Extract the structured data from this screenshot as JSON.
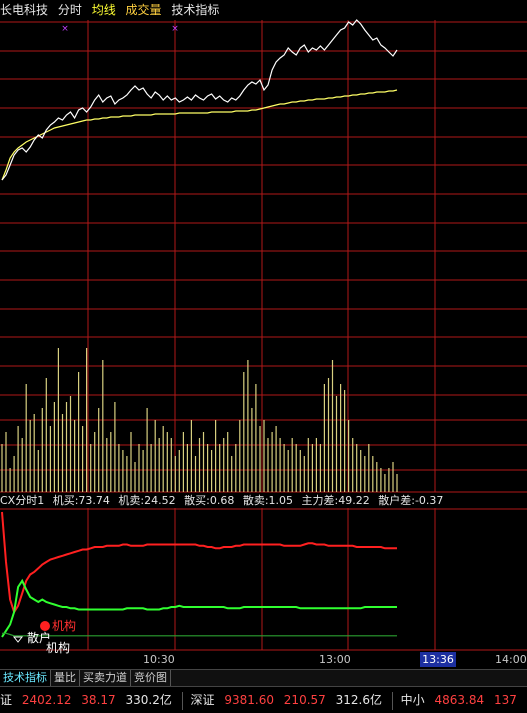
{
  "header": {
    "stock_name": "长电科技",
    "mode_label": "分时",
    "avg_label": "均线",
    "volume_label": "成交量",
    "indicator_label": "技术指标"
  },
  "colors": {
    "price": "#ffffff",
    "avg": "#ffff66",
    "volume": "#d8d080",
    "grid": "#b01818",
    "inst": "#ff2020",
    "retail": "#30ff30",
    "diff": "#2aa030"
  },
  "price_chart": {
    "price": [
      180,
      175,
      165,
      155,
      150,
      148,
      152,
      147,
      140,
      135,
      138,
      130,
      125,
      122,
      118,
      120,
      115,
      112,
      118,
      110,
      108,
      112,
      107,
      100,
      95,
      102,
      98,
      96,
      104,
      100,
      98,
      95,
      90,
      86,
      90,
      88,
      94,
      98,
      92,
      95,
      100,
      96,
      100,
      98,
      102,
      100,
      97,
      100,
      95,
      98,
      100,
      96,
      94,
      99,
      96,
      100,
      102,
      98,
      100,
      96,
      90,
      85,
      82,
      84,
      80,
      90,
      85,
      70,
      62,
      58,
      55,
      48,
      52,
      55,
      48,
      45,
      52,
      48,
      50,
      46,
      50,
      45,
      40,
      35,
      30,
      28,
      22,
      25,
      20,
      24,
      30,
      35,
      40,
      38,
      45,
      48,
      52,
      56,
      50
    ],
    "avg": [
      180,
      170,
      158,
      152,
      148,
      145,
      142,
      140,
      138,
      136,
      134,
      132,
      130,
      128,
      127,
      126,
      125,
      124,
      123,
      122,
      121,
      120,
      120,
      119,
      119,
      118,
      118,
      117,
      117,
      117,
      116,
      116,
      116,
      115,
      115,
      115,
      115,
      115,
      114,
      114,
      114,
      114,
      114,
      114,
      113,
      113,
      113,
      113,
      113,
      113,
      113,
      113,
      112,
      112,
      112,
      112,
      112,
      112,
      111,
      111,
      111,
      111,
      110,
      110,
      109,
      108,
      107,
      106,
      105,
      104,
      104,
      103,
      102,
      102,
      101,
      101,
      100,
      100,
      99,
      99,
      99,
      98,
      98,
      97,
      97,
      96,
      96,
      95,
      95,
      94,
      94,
      93,
      93,
      92,
      92,
      92,
      91,
      91,
      90
    ],
    "volume": [
      40,
      50,
      20,
      30,
      55,
      45,
      90,
      60,
      65,
      35,
      70,
      95,
      55,
      75,
      120,
      65,
      75,
      80,
      60,
      100,
      55,
      120,
      40,
      50,
      70,
      110,
      45,
      50,
      75,
      40,
      35,
      30,
      50,
      25,
      40,
      35,
      70,
      40,
      60,
      45,
      55,
      50,
      45,
      30,
      35,
      50,
      40,
      60,
      30,
      45,
      50,
      40,
      35,
      60,
      40,
      45,
      50,
      30,
      40,
      60,
      100,
      110,
      70,
      90,
      55,
      60,
      45,
      50,
      55,
      45,
      40,
      35,
      45,
      40,
      35,
      30,
      45,
      40,
      45,
      40,
      90,
      95,
      110,
      80,
      90,
      85,
      60,
      45,
      40,
      35,
      30,
      40,
      30,
      25,
      20,
      15,
      20,
      25,
      15
    ]
  },
  "indicator": {
    "title": "CX分时1",
    "values": [
      {
        "label": "机买:73.74",
        "color": "#e6e6e6"
      },
      {
        "label": "机卖:24.52",
        "color": "#e6e6e6"
      },
      {
        "label": "散买:0.68",
        "color": "#e6e6e6"
      },
      {
        "label": "散卖:1.05",
        "color": "#e6e6e6"
      },
      {
        "label": "主力差:49.22",
        "color": "#e6e6e6"
      },
      {
        "label": "散户差:-0.37",
        "color": "#e6e6e6"
      }
    ],
    "inst_line": [
      100,
      60,
      30,
      20,
      25,
      35,
      45,
      50,
      52,
      55,
      58,
      60,
      62,
      63,
      64,
      65,
      66,
      67,
      68,
      69,
      70,
      70,
      71,
      72,
      72,
      72,
      73,
      73,
      73,
      73,
      74,
      74,
      73,
      73,
      73,
      73,
      74,
      74,
      74,
      74,
      74,
      74,
      74,
      74,
      74,
      74,
      74,
      74,
      74,
      73,
      73,
      72,
      72,
      71,
      71,
      72,
      72,
      72,
      73,
      73,
      74,
      74,
      74,
      74,
      74,
      74,
      74,
      74,
      74,
      74,
      73,
      73,
      73,
      73,
      73,
      74,
      75,
      75,
      74,
      74,
      74,
      73,
      73,
      73,
      73,
      73,
      73,
      73,
      72,
      72,
      72,
      72,
      72,
      72,
      72,
      71,
      71,
      71,
      71
    ],
    "retail_line": [
      0,
      5,
      10,
      20,
      40,
      45,
      38,
      32,
      30,
      28,
      30,
      28,
      27,
      26,
      25,
      24,
      24,
      23,
      23,
      22,
      22,
      22,
      22,
      22,
      22,
      22,
      22,
      22,
      22,
      22,
      22,
      23,
      23,
      23,
      23,
      23,
      22,
      22,
      22,
      22,
      23,
      23,
      24,
      24,
      25,
      24,
      24,
      24,
      24,
      24,
      24,
      24,
      24,
      24,
      24,
      24,
      23,
      23,
      23,
      23,
      24,
      24,
      24,
      24,
      24,
      24,
      24,
      24,
      24,
      24,
      24,
      24,
      24,
      24,
      23,
      23,
      23,
      23,
      23,
      23,
      23,
      23,
      23,
      23,
      23,
      23,
      23,
      23,
      23,
      23,
      24,
      24,
      24,
      24,
      24,
      24,
      24,
      24,
      24
    ],
    "retail_diff": [
      3,
      3,
      2,
      1,
      1,
      1,
      1,
      1,
      1,
      1,
      1,
      1,
      1,
      1,
      1,
      1,
      1,
      1,
      1,
      1,
      1,
      1,
      1,
      1,
      1,
      1,
      1,
      1,
      1,
      1,
      1,
      1,
      1,
      1,
      1,
      1,
      1,
      1,
      1,
      1,
      1,
      1,
      1,
      1,
      1,
      1,
      1,
      1,
      1,
      1,
      1,
      1,
      1,
      1,
      1,
      1,
      1,
      1,
      1,
      1,
      1,
      1,
      1,
      1,
      1,
      1,
      1,
      1,
      1,
      1,
      1,
      1,
      1,
      1,
      1,
      1,
      1,
      1,
      1,
      1,
      1,
      1,
      1,
      1,
      1,
      1,
      1,
      1,
      1,
      1,
      1,
      1,
      1,
      1,
      1,
      1,
      1,
      1,
      1
    ],
    "ann_inst": "机构",
    "ann_retail": "散户",
    "ann_inst2": "机构"
  },
  "time_axis": {
    "t1": "10:30",
    "t2": "13:00",
    "current": "13:36",
    "t3": "14:00"
  },
  "tabs": [
    "技术指标",
    "量比",
    "买卖力道",
    "竞价图"
  ],
  "ticker": {
    "sh_name": "证",
    "sh_index": "2402.12",
    "sh_change": "38.17",
    "sh_amount": "330.2亿",
    "sz_name": "深证",
    "sz_index": "9381.60",
    "sz_change": "210.57",
    "sz_amount": "312.6亿",
    "zx_name": "中小",
    "zx_index": "4863.84",
    "zx_change": "137"
  }
}
